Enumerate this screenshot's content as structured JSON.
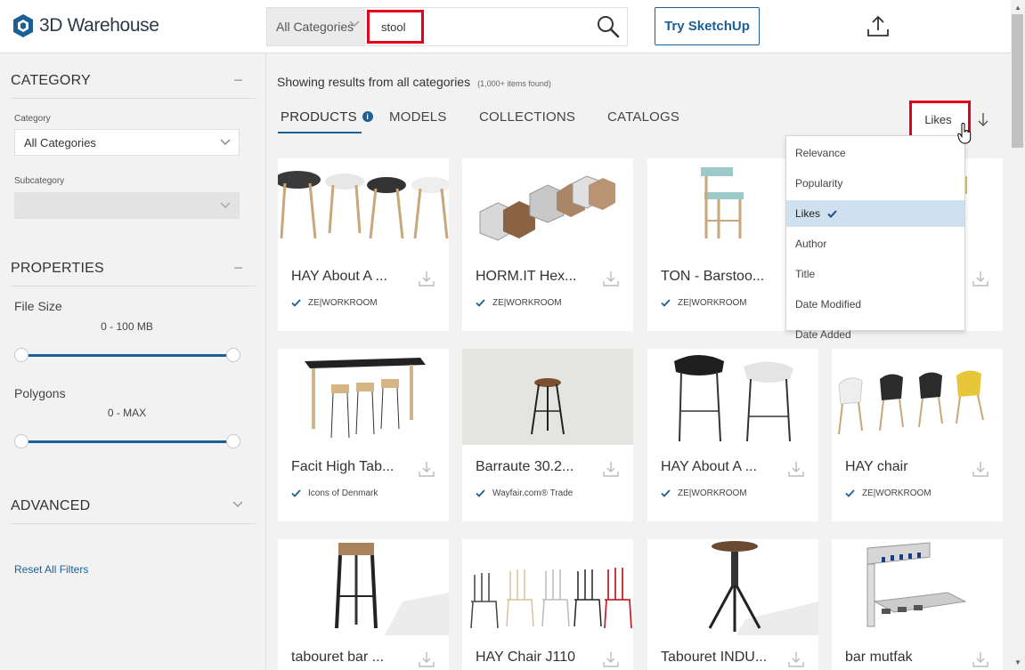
{
  "header": {
    "logo_text": "3D Warehouse",
    "category_dropdown": "All Categories",
    "search_value": "stool",
    "try_button": "Try SketchUp"
  },
  "sidebar": {
    "category_heading": "CATEGORY",
    "category_label": "Category",
    "category_value": "All Categories",
    "subcategory_label": "Subcategory",
    "subcategory_value": "",
    "properties_heading": "PROPERTIES",
    "file_size_label": "File Size",
    "file_size_range": "0 - 100 MB",
    "polygons_label": "Polygons",
    "polygons_range": "0 - MAX",
    "advanced_heading": "ADVANCED",
    "reset_link": "Reset All Filters"
  },
  "main": {
    "results_text": "Showing results from all categories",
    "results_count": "(1,000+ items found)",
    "tabs": [
      {
        "label": "PRODUCTS"
      },
      {
        "label": "MODELS"
      },
      {
        "label": "COLLECTIONS"
      },
      {
        "label": "CATALOGS"
      }
    ],
    "sort_value": "Likes"
  },
  "sort_menu": {
    "items": [
      "Relevance",
      "Popularity",
      "Likes",
      "Author",
      "Title",
      "Date Modified",
      "Date Added"
    ],
    "selected": "Likes"
  },
  "cards": [
    {
      "title": "HAY About A ...",
      "author": "ZE|WORKROOM"
    },
    {
      "title": "HORM.IT Hex...",
      "author": "ZE|WORKROOM"
    },
    {
      "title": "TON - Barstoo...",
      "author": "ZE|WORKROOM"
    },
    {
      "title": "",
      "author": ""
    },
    {
      "title": "Facit High Tab...",
      "author": "Icons of Denmark"
    },
    {
      "title": "Barraute 30.2...",
      "author": "Wayfair.com® Trade"
    },
    {
      "title": "HAY About A ...",
      "author": "ZE|WORKROOM"
    },
    {
      "title": "HAY chair",
      "author": "ZE|WORKROOM"
    },
    {
      "title": "tabouret bar ...",
      "author": ""
    },
    {
      "title": "HAY Chair J110",
      "author": ""
    },
    {
      "title": "Tabouret INDU...",
      "author": ""
    },
    {
      "title": "bar mutfak",
      "author": ""
    }
  ],
  "colors": {
    "accent": "#1a5f96",
    "highlight_box": "#e3001b",
    "menu_selected": "#cfe0ef"
  }
}
